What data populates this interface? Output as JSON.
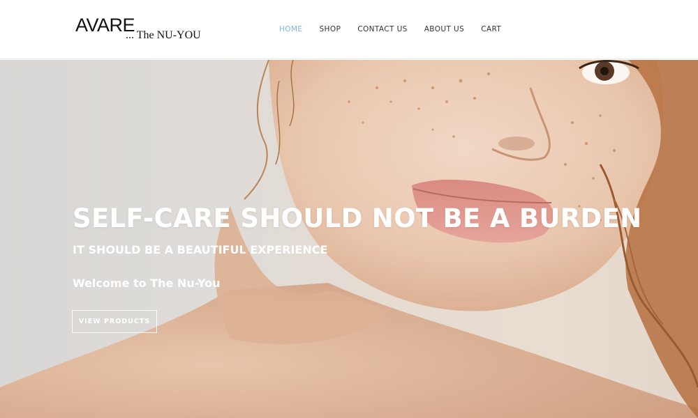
{
  "brand": {
    "logo_main": "AVARE",
    "logo_sub": "... The NU-YOU"
  },
  "nav": {
    "items": [
      {
        "label": "HOME",
        "active": true
      },
      {
        "label": "SHOP",
        "active": false
      },
      {
        "label": "CONTACT US",
        "active": false
      },
      {
        "label": "ABOUT US",
        "active": false
      },
      {
        "label": "CART",
        "active": false
      }
    ]
  },
  "hero": {
    "title": "SELF-CARE SHOULD NOT BE A BURDEN",
    "subtitle": "IT SHOULD BE A BEAUTIFUL EXPERIENCE",
    "welcome": "Welcome to The Nu-You",
    "button_label": "VIEW PRODUCTS",
    "image": "woman-freckles-portrait"
  },
  "colors": {
    "nav_active": "#7fb4e6",
    "nav_text": "#333333",
    "hero_text": "#ffffff"
  }
}
